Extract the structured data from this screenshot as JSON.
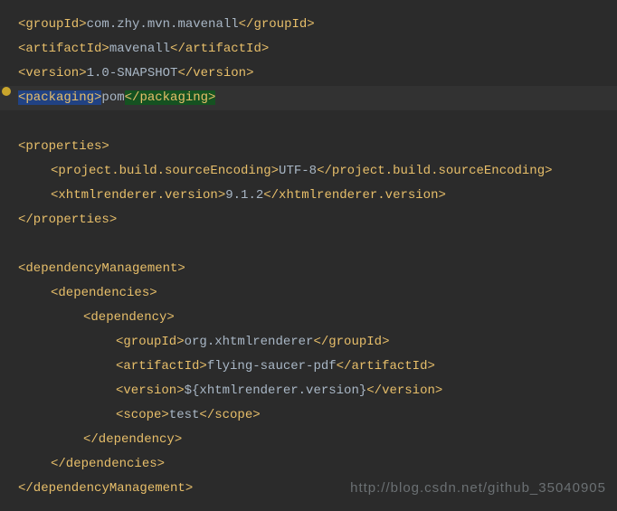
{
  "pom": {
    "groupId": {
      "open": "<groupId>",
      "value": "com.zhy.mvn.mavenall",
      "close": "</groupId>"
    },
    "artifactId": {
      "open": "<artifactId>",
      "value": "mavenall",
      "close": "</artifactId>"
    },
    "version": {
      "open": "<version>",
      "value": "1.0-SNAPSHOT",
      "close": "</version>"
    },
    "packaging": {
      "open": "<packaging>",
      "value": "pom",
      "close": "</packaging>"
    }
  },
  "properties": {
    "open": "<properties>",
    "close": "</properties>",
    "encoding": {
      "open": "<project.build.sourceEncoding>",
      "value": "UTF-8",
      "close": "</project.build.sourceEncoding>"
    },
    "xhtml": {
      "open": "<xhtmlrenderer.version>",
      "value": "9.1.2",
      "close": "</xhtmlrenderer.version>"
    }
  },
  "depMgmt": {
    "open": "<dependencyManagement>",
    "close": "</dependencyManagement>",
    "depsOpen": "<dependencies>",
    "depsClose": "</dependencies>",
    "depOpen": "<dependency>",
    "depClose": "</dependency>",
    "groupId": {
      "open": "<groupId>",
      "value": "org.xhtmlrenderer",
      "close": "</groupId>"
    },
    "artifactId": {
      "open": "<artifactId>",
      "value": "flying-saucer-pdf",
      "close": "</artifactId>"
    },
    "version": {
      "open": "<version>",
      "value": "${xhtmlrenderer.version}",
      "close": "</version>"
    },
    "scope": {
      "open": "<scope>",
      "value": "test",
      "close": "</scope>"
    }
  },
  "watermark": "http://blog.csdn.net/github_35040905"
}
